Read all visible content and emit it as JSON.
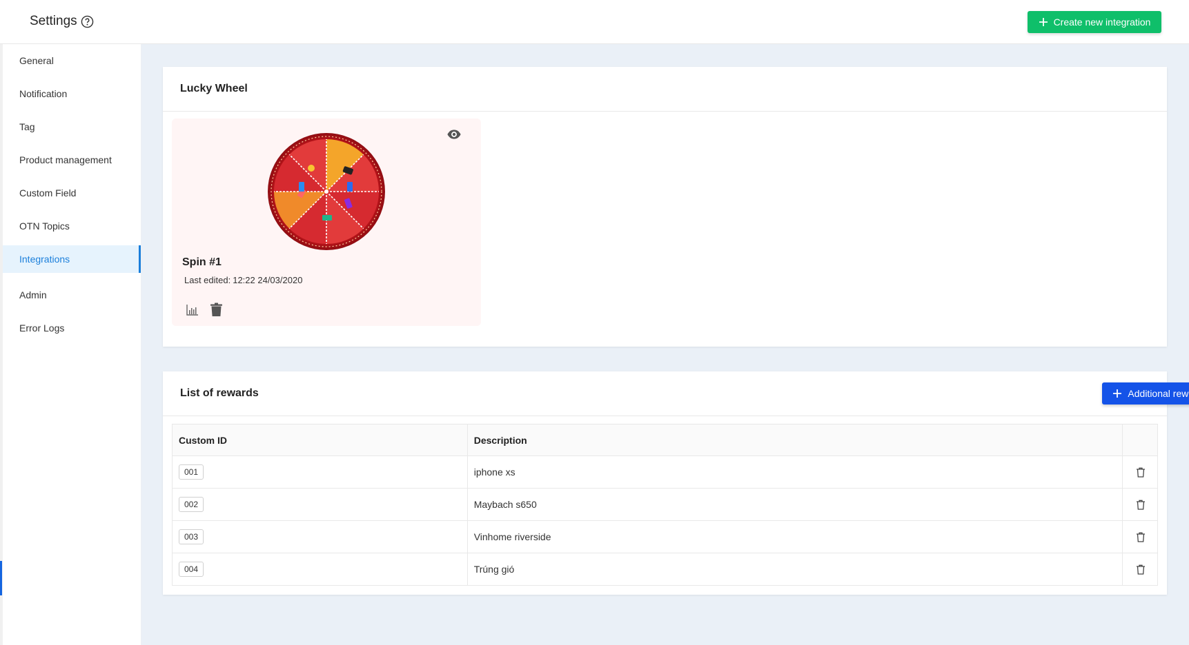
{
  "header": {
    "title": "Settings",
    "create_button_label": "Create new integration"
  },
  "sidebar": {
    "items": [
      {
        "label": "General"
      },
      {
        "label": "Notification"
      },
      {
        "label": "Tag"
      },
      {
        "label": "Product management"
      },
      {
        "label": "Custom Field"
      },
      {
        "label": "OTN Topics"
      },
      {
        "label": "Integrations",
        "active": true
      },
      {
        "label": "Admin"
      },
      {
        "label": "Error Logs"
      }
    ]
  },
  "lucky_wheel": {
    "title": "Lucky Wheel",
    "spin": {
      "name": "Spin #1",
      "edited_label": "Last edited:",
      "edited_value": "12:22 24/03/2020"
    }
  },
  "rewards": {
    "title": "List of rewards",
    "add_button_label": "Additional rewards",
    "columns": [
      "Custom ID",
      "Description",
      ""
    ],
    "rows": [
      {
        "id": "001",
        "description": "iphone xs"
      },
      {
        "id": "002",
        "description": "Maybach s650"
      },
      {
        "id": "003",
        "description": "Vinhome riverside"
      },
      {
        "id": "004",
        "description": "Trúng gió"
      }
    ]
  },
  "colors": {
    "primary_green": "#0fbf6a",
    "primary_blue": "#1453e8",
    "active_nav": "#1b7fdb",
    "wheel_red": "#d9262c",
    "wheel_orange": "#f39b2a"
  }
}
